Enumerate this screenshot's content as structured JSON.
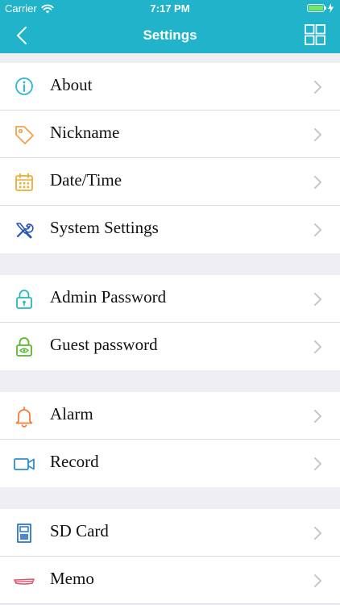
{
  "status_bar": {
    "carrier": "Carrier",
    "time": "7:17 PM",
    "battery_color": "#7be45c"
  },
  "header": {
    "title": "Settings",
    "background_color": "#21b3c9",
    "back_icon": "chevron-left-icon",
    "menu_icon": "grid-icon"
  },
  "groups": [
    {
      "items": [
        {
          "label": "About",
          "icon": "info-icon",
          "color": "#2bb8d8"
        },
        {
          "label": "Nickname",
          "icon": "tag-icon",
          "color": "#f0a24a"
        },
        {
          "label": "Date/Time",
          "icon": "calendar-icon",
          "color": "#efab35"
        },
        {
          "label": "System Settings",
          "icon": "tools-icon",
          "color": "#2b54b8"
        }
      ]
    },
    {
      "items": [
        {
          "label": "Admin Password",
          "icon": "lock-icon",
          "color": "#26bcb2"
        },
        {
          "label": "Guest password",
          "icon": "lock-eye-icon",
          "color": "#58b62d"
        }
      ]
    },
    {
      "items": [
        {
          "label": "Alarm",
          "icon": "bell-icon",
          "color": "#f27d36"
        },
        {
          "label": "Record",
          "icon": "video-camera-icon",
          "color": "#2a8fd4"
        }
      ]
    },
    {
      "items": [
        {
          "label": "SD Card",
          "icon": "sd-card-icon",
          "color": "#2b74c8"
        },
        {
          "label": "Memo",
          "icon": "memo-icon",
          "color": "#e0506e"
        }
      ]
    }
  ]
}
